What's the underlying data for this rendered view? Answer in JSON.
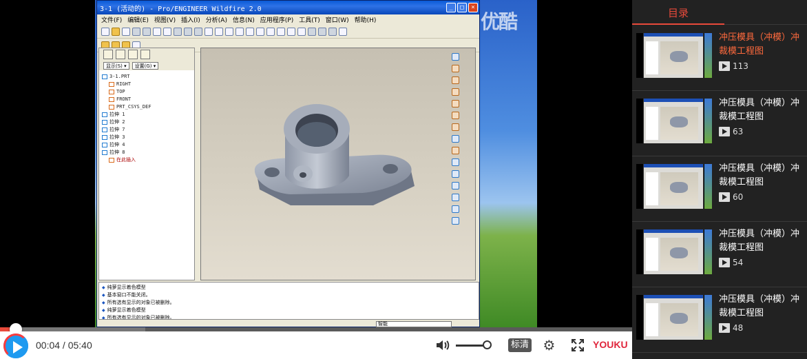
{
  "window": {
    "title": "3-1 (活动的) - Pro/ENGINEER Wildfire 2.0",
    "menus": [
      "文件(F)",
      "编辑(E)",
      "视图(V)",
      "插入(I)",
      "分析(A)",
      "信息(N)",
      "应用程序(P)",
      "工具(T)",
      "窗口(W)",
      "帮助(H)"
    ]
  },
  "watermark": "优酷",
  "model_tree": {
    "dropdowns": [
      "显示(S) ▾",
      "设置(G) ▾"
    ],
    "nodes": [
      {
        "label": "3-1.PRT",
        "level": 0
      },
      {
        "label": "RIGHT",
        "level": 1
      },
      {
        "label": "TOP",
        "level": 1
      },
      {
        "label": "FRONT",
        "level": 1
      },
      {
        "label": "PRT_CSYS_DEF",
        "level": 1
      },
      {
        "label": "拉伸 1",
        "level": 0
      },
      {
        "label": "拉伸 2",
        "level": 0
      },
      {
        "label": "拉伸 7",
        "level": 0
      },
      {
        "label": "拉伸 3",
        "level": 0
      },
      {
        "label": "拉伸 4",
        "level": 0
      },
      {
        "label": "拉伸 8",
        "level": 0
      },
      {
        "label": "在此插入",
        "level": 1
      }
    ]
  },
  "messages": [
    "纯萝显示着色模型",
    "基本窗口不能关闭。",
    "所有选有显示的对象已被删除。",
    "纯萝显示着色模型",
    "所有选有显示的对象已被删除。"
  ],
  "status_select": "智能",
  "player": {
    "current_time": "00:04",
    "duration": "05:40",
    "progress_fraction": 0.012,
    "buffered_fraction": 0.23,
    "volume_fraction": 0.9,
    "quality": "标清",
    "brand": "YOUKU",
    "colors": {
      "accent": "#e84a3b",
      "brand": "#e0263c"
    }
  },
  "playlist": {
    "heading": "目录",
    "items": [
      {
        "title": "冲压模具（冲模）冲裁模工程图",
        "plays": "113",
        "active": true
      },
      {
        "title": "冲压模具（冲模）冲裁模工程图",
        "plays": "63",
        "active": false
      },
      {
        "title": "冲压模具（冲模）冲裁模工程图",
        "plays": "60",
        "active": false
      },
      {
        "title": "冲压模具（冲模）冲裁模工程图",
        "plays": "54",
        "active": false
      },
      {
        "title": "冲压模具（冲模）冲裁模工程图",
        "plays": "48",
        "active": false
      }
    ]
  }
}
